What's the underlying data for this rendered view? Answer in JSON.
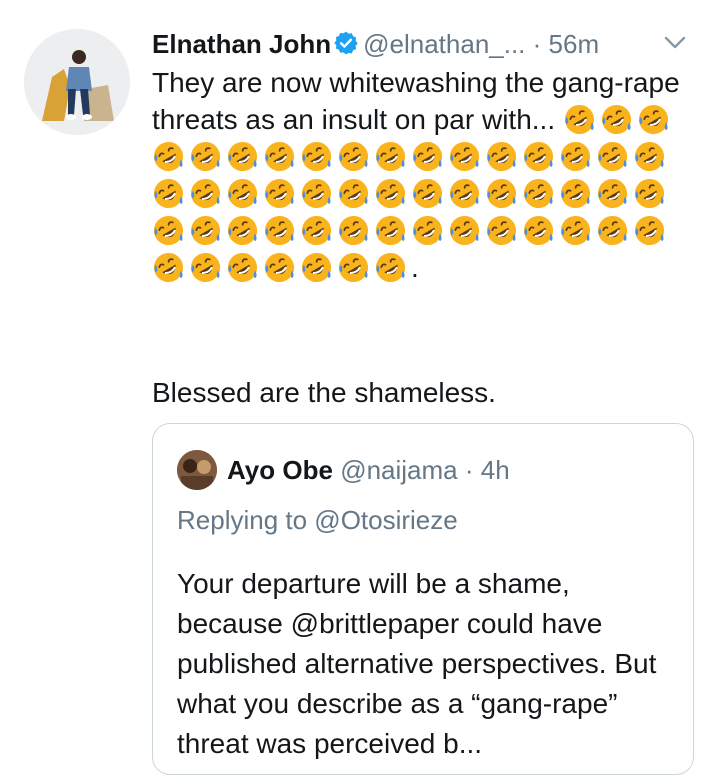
{
  "tweet": {
    "author_name": "Elnathan John",
    "author_handle": "@elnathan_...",
    "time": "· 56m",
    "verified": true,
    "text_start": "They are now whitewashing the gang-rape threats as an insult on par with...",
    "emoji_icon": "rolling-on-floor-laughing-emoji",
    "emoji_count": 52,
    "text_end": ".",
    "second_line": "Blessed are the shameless."
  },
  "quoted_tweet": {
    "author_name": "Ayo Obe",
    "author_handle": "@naijama",
    "time": "· 4h",
    "replying_to": "Replying to @Otosirieze",
    "text": "Your departure will be a shame, because @brittlepaper could have published alternative perspectives. But what you describe as a “gang-rape” threat was perceived b..."
  },
  "colors": {
    "text": "#14171a",
    "muted": "#657786",
    "verified_blue": "#1da1f2",
    "border": "#ccd6dd",
    "emoji_face": "#f9b31d"
  }
}
